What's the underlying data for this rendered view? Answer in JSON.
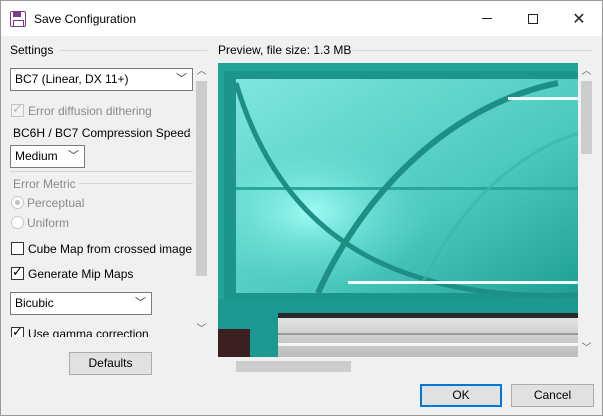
{
  "window": {
    "title": "Save Configuration",
    "icon": "floppy-disk-icon",
    "controls": {
      "minimize": "minimize-icon",
      "maximize": "maximize-icon",
      "close": "close-icon"
    }
  },
  "settings": {
    "group_label": "Settings",
    "format_select": {
      "value": "BC7 (Linear, DX 11+)"
    },
    "error_diffusion_dithering": {
      "label": "Error diffusion dithering",
      "checked": true,
      "enabled": false
    },
    "compression_speed": {
      "label": "BC6H / BC7 Compression Speed",
      "value": "Medium"
    },
    "error_metric": {
      "label": "Error Metric",
      "options": [
        {
          "label": "Perceptual",
          "selected": true
        },
        {
          "label": "Uniform",
          "selected": false
        }
      ]
    },
    "cube_map": {
      "label": "Cube Map from crossed image",
      "checked": false
    },
    "generate_mip_maps": {
      "label": "Generate Mip Maps",
      "checked": true
    },
    "mip_filter": {
      "value": "Bicubic"
    },
    "gamma_correction": {
      "label": "Use gamma correction",
      "checked": true
    },
    "defaults_button": "Defaults"
  },
  "preview": {
    "label": "Preview, file size: 1.3 MB"
  },
  "footer": {
    "ok": "OK",
    "cancel": "Cancel"
  },
  "colors": {
    "accent": "#0078d7",
    "preview_teal": "#22a39a",
    "preview_light": "#7eeee5"
  }
}
